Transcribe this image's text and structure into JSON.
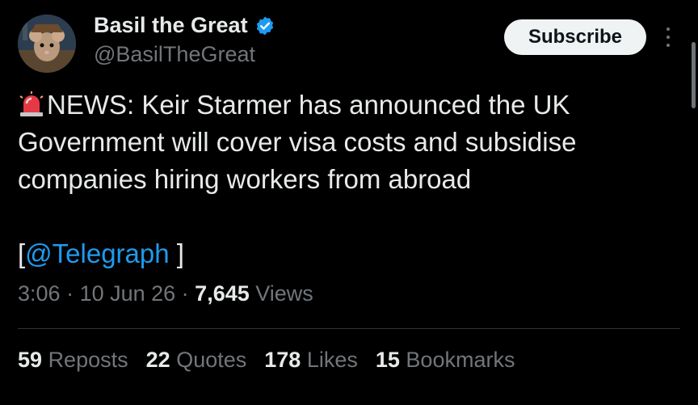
{
  "author": {
    "name": "Basil the Great",
    "handle": "@BasilTheGreat",
    "verified": true,
    "avatar_icon": "mouse-detective-avatar"
  },
  "subscribe_label": "Subscribe",
  "tweet": {
    "emoji": "siren-icon",
    "text": "NEWS: Keir Starmer has announced the UK Government will cover visa costs and subsidise companies hiring workers from abroad",
    "source_open": "[",
    "source_link": "@Telegraph",
    "source_close": " ]"
  },
  "meta": {
    "time": "3:06",
    "sep1": " · ",
    "date": "10 Jun 26",
    "sep2": " · ",
    "views_count": "7,645",
    "views_label": " Views"
  },
  "stats": [
    {
      "count": "59",
      "label": "Reposts"
    },
    {
      "count": "22",
      "label": "Quotes"
    },
    {
      "count": "178",
      "label": "Likes"
    },
    {
      "count": "15",
      "label": "Bookmarks"
    }
  ],
  "colors": {
    "background": "#000000",
    "text": "#e7e9ea",
    "muted": "#71767b",
    "link": "#1d9bf0",
    "verified": "#1d9bf0",
    "button_bg": "#eff3f4"
  }
}
